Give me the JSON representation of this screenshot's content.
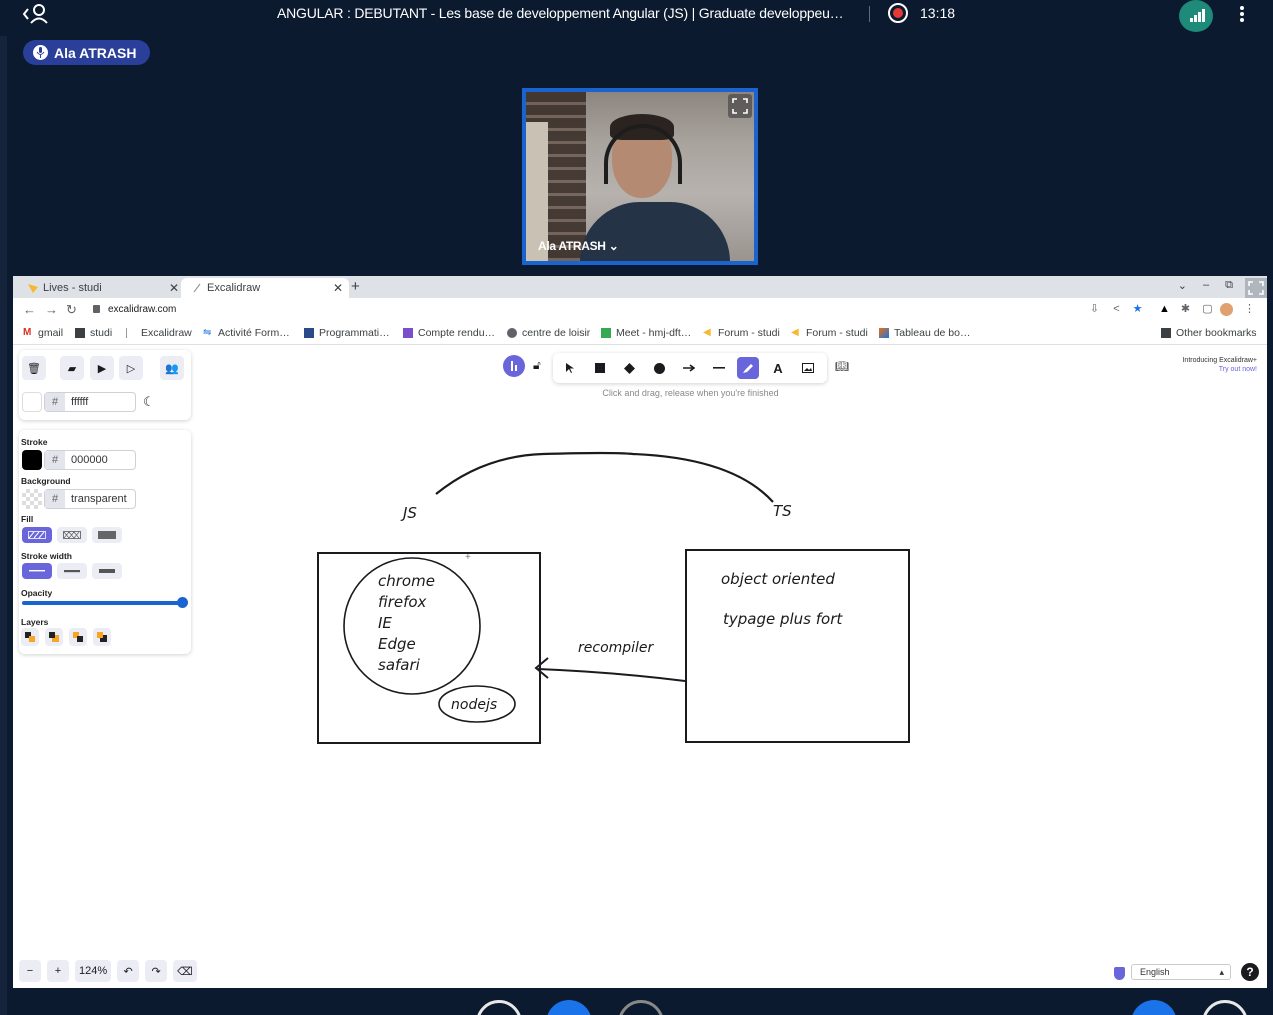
{
  "meet": {
    "title": "ANGULAR : DEBUTANT - Les base de developpement Angular (JS) | Graduate developpeu…",
    "clock": "13:18",
    "speaker": "Ala ATRASH",
    "video_name": "Ala ATRASH ⌄"
  },
  "browser": {
    "tabs": [
      {
        "label": "Lives - studi"
      },
      {
        "label": "Excalidraw"
      }
    ],
    "url": "excalidraw.com",
    "bookmarks": [
      "gmail",
      "studi",
      "Excalidraw",
      "Activité Form…",
      "Programmati…",
      "Compte rendu…",
      "centre de loisir",
      "Meet - hmj-dft…",
      "Forum - studi",
      "Forum - studi",
      "Tableau de bo…"
    ],
    "other_bookmarks": "Other bookmarks"
  },
  "excalidraw": {
    "canvas_bg": "ffffff",
    "hint": "Click and drag, release when you're finished",
    "promo_line1": "Introducing Excalidraw+",
    "promo_line2": "Try out now!",
    "panel": {
      "stroke_label": "Stroke",
      "stroke_value": "000000",
      "background_label": "Background",
      "background_value": "transparent",
      "fill_label": "Fill",
      "stroke_width_label": "Stroke width",
      "opacity_label": "Opacity",
      "layers_label": "Layers"
    },
    "zoom": "124%",
    "language": "English",
    "drawing": {
      "js_label": "JS",
      "ts_label": "TS",
      "browsers": [
        "chrome",
        "firefox",
        "IE",
        "Edge",
        "safari"
      ],
      "nodejs": "nodejs",
      "arrow_label": "recompiler",
      "ts_features": [
        "object oriented",
        "typage plus fort"
      ]
    },
    "accent": "#6965db"
  }
}
